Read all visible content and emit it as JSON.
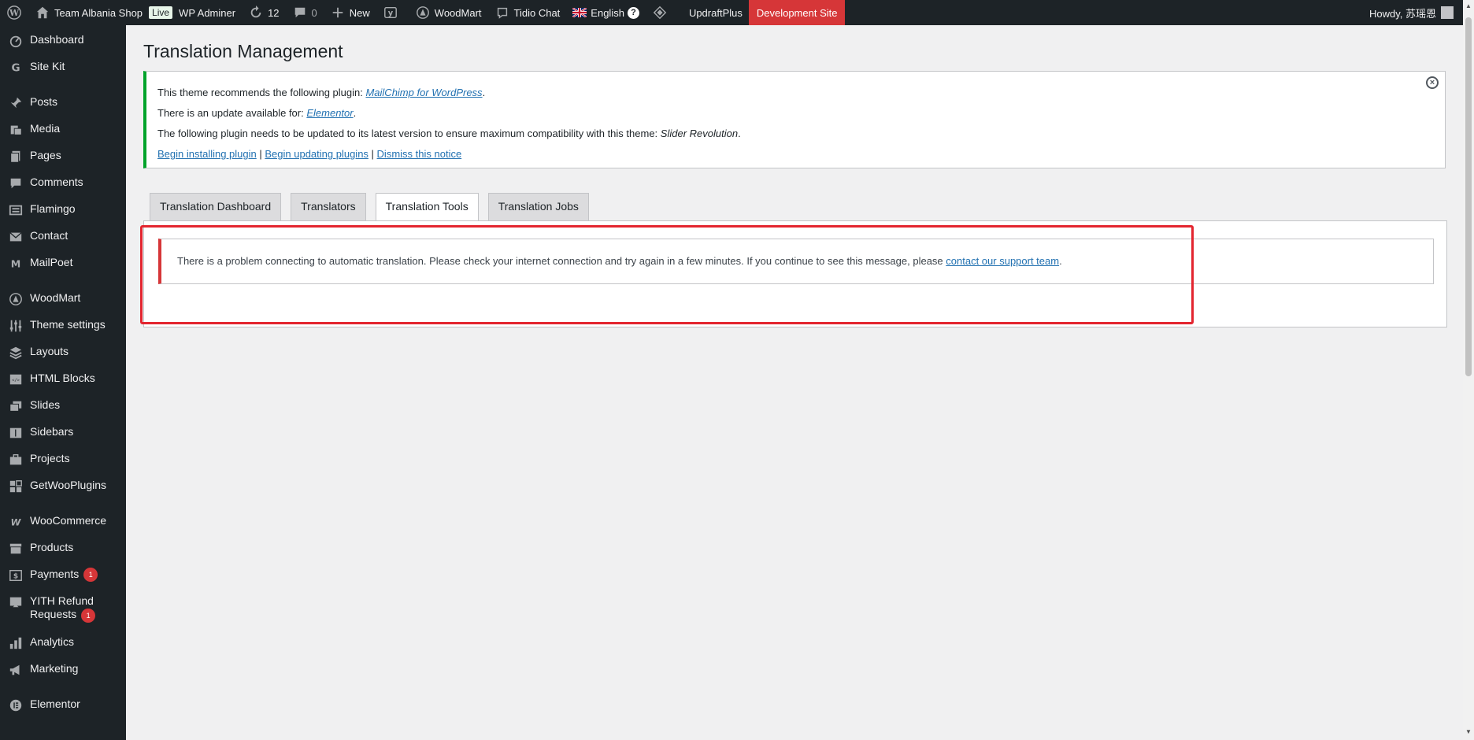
{
  "adminbar": {
    "site_name": "Team Albania Shop",
    "live_badge": "Live",
    "wp_adminer": "WP Adminer",
    "updates_count": "12",
    "comments_count": "0",
    "new_label": "New",
    "woodmart": "WoodMart",
    "tidio": "Tidio Chat",
    "language": "English",
    "updraft": "UpdraftPlus",
    "dev_site": "Development Site",
    "howdy": "Howdy, 苏瑶恩"
  },
  "sidebar": {
    "items": [
      {
        "label": "Dashboard",
        "icon": "dashboard-icon"
      },
      {
        "label": "Site Kit",
        "icon": "google-icon"
      },
      {
        "label": "Posts",
        "icon": "pin-icon"
      },
      {
        "label": "Media",
        "icon": "media-icon"
      },
      {
        "label": "Pages",
        "icon": "pages-icon"
      },
      {
        "label": "Comments",
        "icon": "comment-icon"
      },
      {
        "label": "Flamingo",
        "icon": "flamingo-icon"
      },
      {
        "label": "Contact",
        "icon": "mail-icon"
      },
      {
        "label": "MailPoet",
        "icon": "mailpoet-icon"
      },
      {
        "label": "WoodMart",
        "icon": "woodmart-icon"
      },
      {
        "label": "Theme settings",
        "icon": "settings-sliders-icon"
      },
      {
        "label": "Layouts",
        "icon": "layers-icon"
      },
      {
        "label": "HTML Blocks",
        "icon": "html-icon"
      },
      {
        "label": "Slides",
        "icon": "slides-icon"
      },
      {
        "label": "Sidebars",
        "icon": "sidebar-icon"
      },
      {
        "label": "Projects",
        "icon": "briefcase-icon"
      },
      {
        "label": "GetWooPlugins",
        "icon": "plugin-grid-icon"
      },
      {
        "label": "WooCommerce",
        "icon": "woocommerce-icon"
      },
      {
        "label": "Products",
        "icon": "archive-icon"
      },
      {
        "label": "Payments",
        "icon": "dollar-icon",
        "badge": "1"
      },
      {
        "label": "YITH Refund",
        "label2": "Requests",
        "icon": "refund-icon",
        "badge": "1"
      },
      {
        "label": "Analytics",
        "icon": "chart-icon"
      },
      {
        "label": "Marketing",
        "icon": "megaphone-icon"
      },
      {
        "label": "Elementor",
        "icon": "elementor-icon"
      }
    ]
  },
  "main": {
    "title": "Translation Management",
    "notice": {
      "line1_prefix": "This theme recommends the following plugin: ",
      "line1_link": "MailChimp for WordPress",
      "line2_prefix": "There is an update available for: ",
      "line2_link": "Elementor",
      "line3_prefix": "The following plugin needs to be updated to its latest version to ensure maximum compatibility with this theme: ",
      "line3_em": "Slider Revolution",
      "action1": "Begin installing plugin",
      "action2": "Begin updating plugins",
      "action3": "Dismiss this notice"
    },
    "tabs": [
      "Translation Dashboard",
      "Translators",
      "Translation Tools",
      "Translation Jobs"
    ],
    "active_tab": "Translation Tools",
    "error": {
      "text": "There is a problem connecting to automatic translation. Please check your internet connection and try again in a few minutes. If you continue to see this message, please ",
      "link": "contact our support team"
    }
  }
}
